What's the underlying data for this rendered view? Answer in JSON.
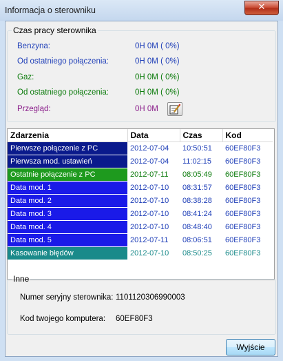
{
  "window": {
    "title": "Informacja o sterowniku",
    "close_glyph": "✕"
  },
  "runtime": {
    "legend": "Czas pracy sterownika",
    "rows": [
      {
        "label": "Benzyna:",
        "value": "0H  0M ( 0%)",
        "color": "#1f3fb8"
      },
      {
        "label": "Od ostatniego połączenia:",
        "value": "0H  0M ( 0%)",
        "color": "#1f3fb8"
      },
      {
        "label": "Gaz:",
        "value": "0H  0M ( 0%)",
        "color": "#0a7a0a"
      },
      {
        "label": "Od ostatniego połączenia:",
        "value": "0H  0M ( 0%)",
        "color": "#0a7a0a"
      },
      {
        "label": "Przegląd:",
        "value": "0H  0M",
        "color": "#8a1d8a"
      }
    ],
    "edit_icon": "notepad-pencil-icon"
  },
  "events": {
    "columns": [
      "Zdarzenia",
      "Data",
      "Czas",
      "Kod"
    ],
    "rows": [
      {
        "event": "Pierwsze połączenie z PC",
        "date": "2012-07-04",
        "time": "10:50:51",
        "code": "60EF80F3",
        "bg": "#0a1a8c",
        "fg": "#1f3fb8"
      },
      {
        "event": "Pierwsza mod. ustawień",
        "date": "2012-07-04",
        "time": "11:02:15",
        "code": "60EF80F3",
        "bg": "#0a1a8c",
        "fg": "#1f3fb8"
      },
      {
        "event": "Ostatnie połączenie z PC",
        "date": "2012-07-11",
        "time": "08:05:49",
        "code": "60EF80F3",
        "bg": "#1e9a1e",
        "fg": "#0a7a0a"
      },
      {
        "event": "Data mod. 1",
        "date": "2012-07-10",
        "time": "08:31:57",
        "code": "60EF80F3",
        "bg": "#1a1ae8",
        "fg": "#1f3fb8"
      },
      {
        "event": "Data mod. 2",
        "date": "2012-07-10",
        "time": "08:38:28",
        "code": "60EF80F3",
        "bg": "#1a1ae8",
        "fg": "#1f3fb8"
      },
      {
        "event": "Data mod. 3",
        "date": "2012-07-10",
        "time": "08:41:24",
        "code": "60EF80F3",
        "bg": "#1a1ae8",
        "fg": "#1f3fb8"
      },
      {
        "event": "Data mod. 4",
        "date": "2012-07-10",
        "time": "08:48:40",
        "code": "60EF80F3",
        "bg": "#1a1ae8",
        "fg": "#1f3fb8"
      },
      {
        "event": "Data mod. 5",
        "date": "2012-07-11",
        "time": "08:06:51",
        "code": "60EF80F3",
        "bg": "#1a1ae8",
        "fg": "#1f3fb8"
      },
      {
        "event": "Kasowanie błędów",
        "date": "2012-07-10",
        "time": "08:50:25",
        "code": "60EF80F3",
        "bg": "#1a8a8a",
        "fg": "#1a8a8a"
      }
    ]
  },
  "other": {
    "legend": "Inne",
    "serial_label": "Numer seryjny sterownika:",
    "serial_value": "1101120306990003",
    "computer_label": "Kod twojego komputera:",
    "computer_value": "60EF80F3"
  },
  "buttons": {
    "exit": "Wyjście"
  }
}
